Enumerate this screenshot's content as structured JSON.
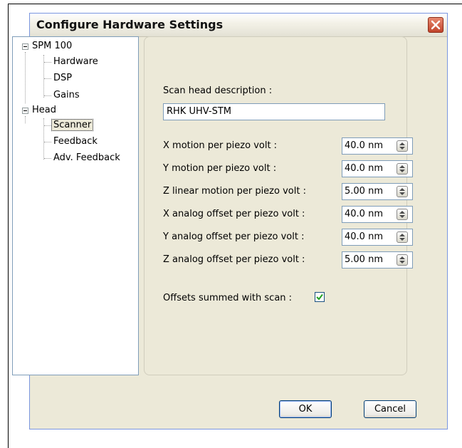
{
  "dialog": {
    "title": "Configure Hardware Settings"
  },
  "tree": {
    "root1": "SPM 100",
    "root1_children": [
      "Hardware",
      "DSP",
      "Gains"
    ],
    "root2": "Head",
    "root2_children": [
      "Scanner",
      "Feedback",
      "Adv. Feedback"
    ],
    "selected": "Scanner"
  },
  "scanner": {
    "description_label": "Scan head description :",
    "description_value": "RHK UHV-STM",
    "fields": [
      {
        "label": "X motion per piezo volt :",
        "value": "40.0 nm"
      },
      {
        "label": "Y motion per piezo volt :",
        "value": "40.0 nm"
      },
      {
        "label": "Z linear motion per piezo volt :",
        "value": "5.00 nm"
      },
      {
        "label": "X analog offset per piezo volt :",
        "value": "40.0 nm"
      },
      {
        "label": "Y analog offset per piezo volt :",
        "value": "40.0 nm"
      },
      {
        "label": "Z analog offset per piezo volt :",
        "value": "5.00 nm"
      }
    ],
    "offsets_label": "Offsets summed with scan :",
    "offsets_checked": true
  },
  "buttons": {
    "ok": "OK",
    "cancel": "Cancel"
  },
  "colors": {
    "dialog_bg": "#ece9d8",
    "close_button": "#c1442b",
    "checkbox_mark": "#21a121",
    "field_border": "#7f9db9"
  },
  "icons": [
    "close-icon",
    "tree-collapse-icon",
    "spin-updown-icon",
    "checkmark-icon"
  ]
}
